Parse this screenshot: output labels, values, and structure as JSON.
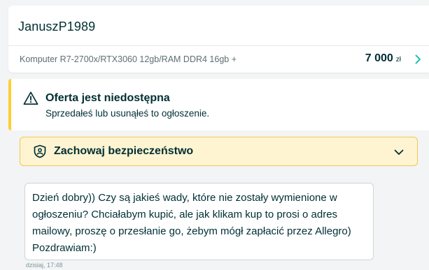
{
  "header": {
    "username": "JanuszP1989",
    "listing_title": "Komputer R7-2700x/RTX3060 12gb/RAM DDR4 16gb +",
    "price": "7 000",
    "currency": "zł"
  },
  "warning": {
    "title": "Oferta jest niedostępna",
    "text": "Sprzedałeś lub usunąłeś to ogłoszenie."
  },
  "safety": {
    "label": "Zachowaj bezpieczeństwo"
  },
  "message": {
    "text": "Dzień dobry)) Czy są jakieś wady, które nie zostały wymienione w ogłoszeniu? Chciałabym kupić, ale jak klikam kup to prosi o adres mailowy, proszę o przesłanie go, żebym mógł zapłacić przez Allegro) Pozdrawiam:)",
    "time": "dzisiaj, 17:48"
  },
  "colors": {
    "background": "#f2f4f5",
    "primary_text": "#002f34",
    "accent_teal": "#23e5db",
    "warning_yellow": "#ffce32",
    "safety_bg": "#fff4d1"
  },
  "icons": {
    "warning": "warning-triangle-icon",
    "safety": "shield-person-icon",
    "listing_link": "chevron-right-icon",
    "expand": "chevron-down-icon"
  }
}
